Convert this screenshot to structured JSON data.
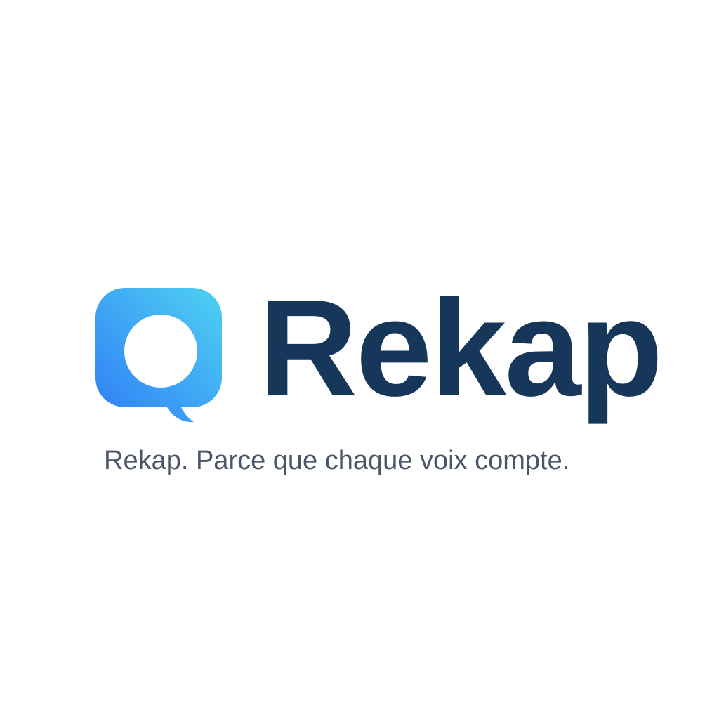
{
  "brand": {
    "name": "Rekap",
    "tagline": "Rekap. Parce que chaque voix compte.",
    "icon": "speech-bubble-icon",
    "colors": {
      "wordmark": "#16365a",
      "tagline": "#4a5568",
      "icon_gradient_start": "#2f7df6",
      "icon_gradient_end": "#4fd2f2",
      "background": "#ffffff"
    }
  }
}
